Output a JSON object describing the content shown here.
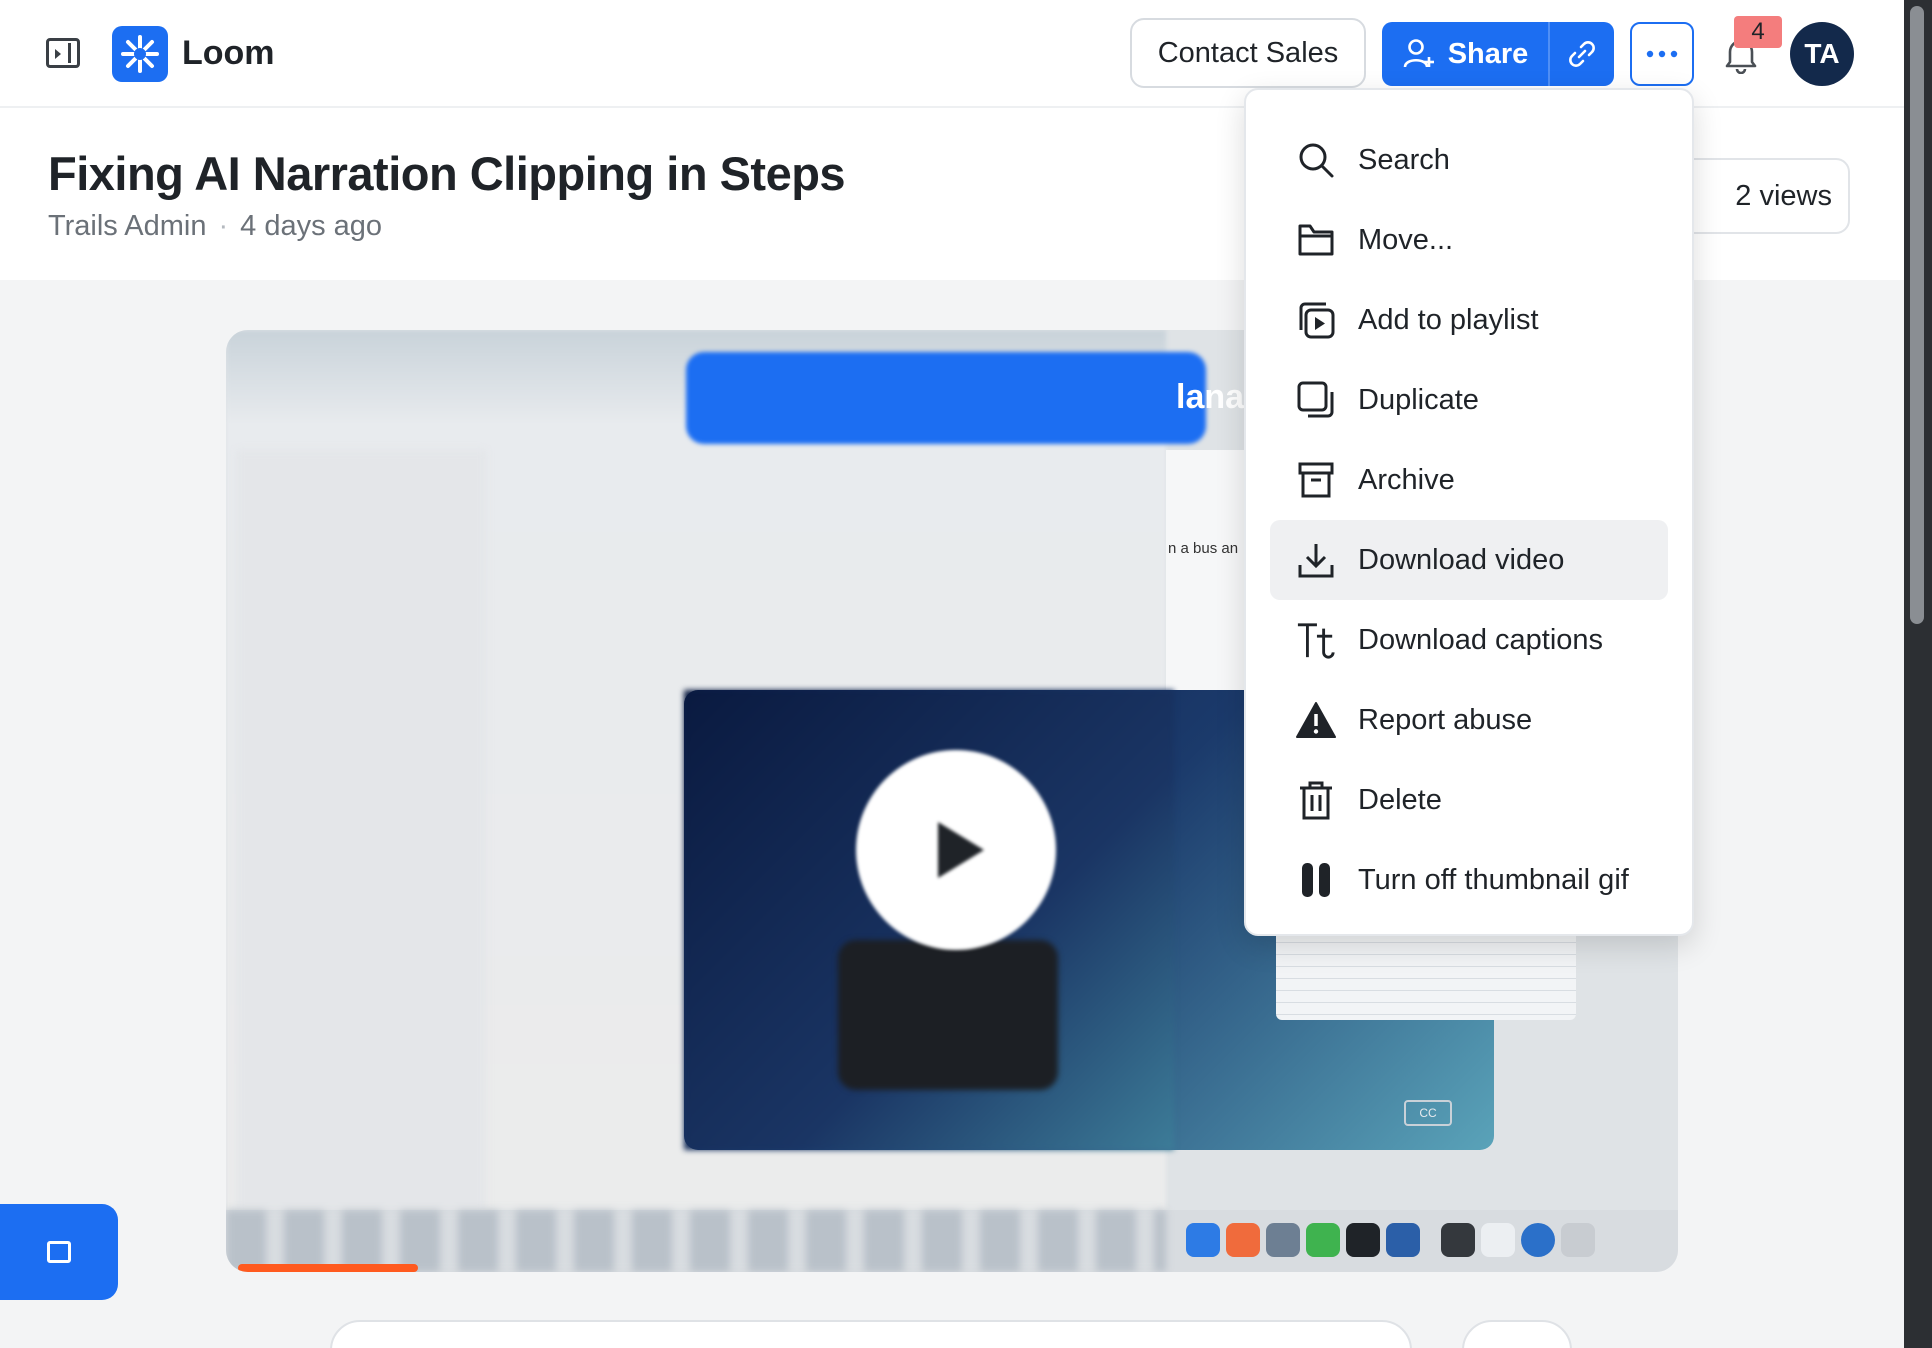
{
  "header": {
    "logo_text": "Loom",
    "contact_sales_label": "Contact Sales",
    "share_label": "Share",
    "notification_count": "4",
    "avatar_initials": "TA"
  },
  "video": {
    "title": "Fixing AI Narration Clipping in Steps",
    "author": "Trails Admin",
    "separator": "·",
    "posted": "4 days ago",
    "views": "2 views",
    "frame_overlay_text": "lana",
    "frame_snippet_text": "n a bus an",
    "frame_cc_label": "CC"
  },
  "menu": {
    "items": [
      {
        "label": "Search",
        "icon": "search-icon"
      },
      {
        "label": "Move...",
        "icon": "folder-icon"
      },
      {
        "label": "Add to playlist",
        "icon": "playlist-icon"
      },
      {
        "label": "Duplicate",
        "icon": "duplicate-icon"
      },
      {
        "label": "Archive",
        "icon": "archive-icon"
      },
      {
        "label": "Download video",
        "icon": "download-icon"
      },
      {
        "label": "Download captions",
        "icon": "captions-icon"
      },
      {
        "label": "Report abuse",
        "icon": "warning-icon"
      },
      {
        "label": "Delete",
        "icon": "trash-icon"
      },
      {
        "label": "Turn off thumbnail gif",
        "icon": "pause-icon"
      }
    ],
    "highlighted_item": "Download video"
  },
  "colors": {
    "accent": "#1c6ef2",
    "avatar_bg": "#13294b",
    "badge_bg": "#f47d7d"
  }
}
